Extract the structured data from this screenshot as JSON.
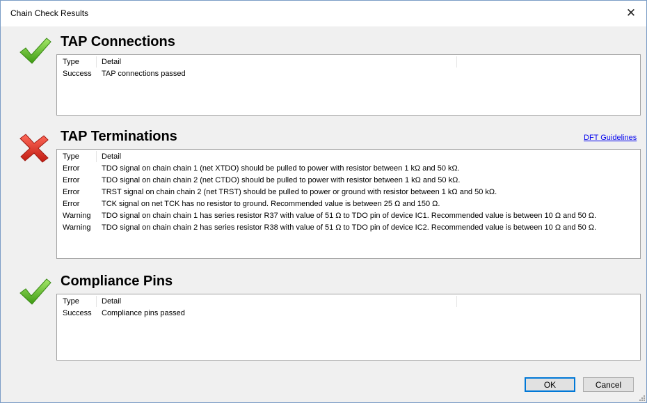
{
  "window": {
    "title": "Chain Check Results",
    "close_glyph": "✕"
  },
  "columns": {
    "type": "Type",
    "detail": "Detail"
  },
  "sections": [
    {
      "title": "TAP Connections",
      "status_icon": "checkmark-icon",
      "rows": [
        {
          "type": "Success",
          "detail": "TAP connections passed"
        }
      ]
    },
    {
      "title": "TAP Terminations",
      "status_icon": "x-icon",
      "link": "DFT Guidelines",
      "rows": [
        {
          "type": "Error",
          "detail": "TDO signal on chain chain 1 (net XTDO) should be pulled to power with resistor between 1 kΩ and 50 kΩ."
        },
        {
          "type": "Error",
          "detail": "TDO signal on chain chain 2 (net CTDO) should be pulled to power with resistor between 1 kΩ and 50 kΩ."
        },
        {
          "type": "Error",
          "detail": "TRST signal on chain chain 2 (net TRST) should be pulled to power or ground with resistor between 1 kΩ and 50 kΩ."
        },
        {
          "type": "Error",
          "detail": "TCK signal on net TCK has no resistor to ground. Recommended value is between 25 Ω and 150 Ω."
        },
        {
          "type": "Warning",
          "detail": "TDO signal on chain chain 1 has series resistor R37 with value of 51 Ω to TDO pin of device IC1. Recommended value is between 10 Ω and 50 Ω."
        },
        {
          "type": "Warning",
          "detail": "TDO signal on chain chain 2 has series resistor R38 with value of 51 Ω to TDO pin of device IC2. Recommended value is between 10 Ω and 50 Ω."
        }
      ]
    },
    {
      "title": "Compliance Pins",
      "status_icon": "checkmark-icon",
      "rows": [
        {
          "type": "Success",
          "detail": "Compliance pins passed"
        }
      ]
    }
  ],
  "buttons": {
    "ok": "OK",
    "cancel": "Cancel"
  },
  "colors": {
    "success": "#5cb82a",
    "error": "#d92626",
    "link": "#0000ee",
    "accent": "#0078d7"
  }
}
